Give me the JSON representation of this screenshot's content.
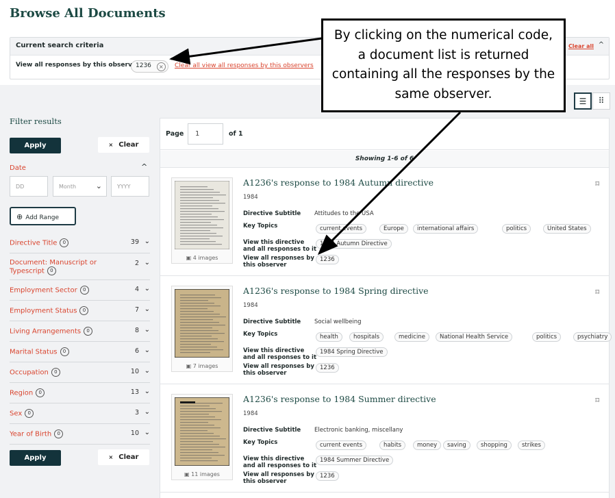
{
  "page": {
    "title": "Browse All Documents"
  },
  "criteria": {
    "header": "Current search criteria",
    "row_label": "View all responses by this observer",
    "chip_value": "1236",
    "chip_remove": "×",
    "clear_link": "Clear all view all responses by this observers",
    "clear_all": "Clear all",
    "collapse": "^"
  },
  "view": {
    "list_icon": "☰",
    "grid_icon": "⠿"
  },
  "filters": {
    "title": "Filter results",
    "apply": "Apply",
    "clear": "Clear",
    "clear_icon": "×",
    "date": {
      "label": "Date",
      "caret": "^",
      "dd_placeholder": "DD",
      "month_placeholder": "Month",
      "month_caret": "⌄",
      "yyyy_placeholder": "YYYY",
      "add_range": "Add Range",
      "add_icon": "⊕"
    },
    "facets": [
      {
        "label": "Directive Title",
        "badge": "0",
        "count": "39"
      },
      {
        "label": "Document: Manuscript or Typescript",
        "badge": "0",
        "count": "2"
      },
      {
        "label": "Employment Sector",
        "badge": "0",
        "count": "4"
      },
      {
        "label": "Employment Status",
        "badge": "0",
        "count": "7"
      },
      {
        "label": "Living Arrangements",
        "badge": "0",
        "count": "8"
      },
      {
        "label": "Marital Status",
        "badge": "0",
        "count": "6"
      },
      {
        "label": "Occupation",
        "badge": "0",
        "count": "10"
      },
      {
        "label": "Region",
        "badge": "0",
        "count": "13"
      },
      {
        "label": "Sex",
        "badge": "0",
        "count": "3"
      },
      {
        "label": "Year of Birth",
        "badge": "0",
        "count": "10"
      }
    ],
    "facet_caret": "⌄"
  },
  "results": {
    "page_label": "Page",
    "page_value": "1",
    "of_label": "of 1",
    "showing": "Showing 1-6 of 6",
    "labels": {
      "directive_subtitle": "Directive Subtitle",
      "key_topics": "Key Topics",
      "view_directive_1": "View this directive",
      "view_directive_2": "and all responses to it",
      "view_observer_1": "View all responses by",
      "view_observer_2": "this observer"
    },
    "bookmark_icon": "⌑",
    "items": [
      {
        "title": "A1236's response to 1984 Autumn directive",
        "year": "1984",
        "subtitle": "Attitudes to the USA",
        "topics": [
          "current events",
          "Europe",
          "international affairs",
          "politics",
          "United States"
        ],
        "directive": "1984 Autumn Directive",
        "observer": "1236",
        "images": "4 images"
      },
      {
        "title": "A1236's response to 1984 Spring directive",
        "year": "1984",
        "subtitle": "Social wellbeing",
        "topics": [
          "health",
          "hospitals",
          "medicine",
          "National Health Service",
          "politics",
          "psychiatry"
        ],
        "directive": "1984 Spring Directive",
        "observer": "1236",
        "images": "7 images"
      },
      {
        "title": "A1236's response to 1984 Summer directive",
        "year": "1984",
        "subtitle": "Electronic banking, miscellany",
        "topics": [
          "current events",
          "habits",
          "money",
          "saving",
          "shopping",
          "strikes"
        ],
        "directive": "1984 Summer Directive",
        "observer": "1236",
        "images": "11 images"
      }
    ]
  },
  "callout": {
    "line1": "By clicking on the numerical code,",
    "line2": "a document list is returned",
    "line3": "containing all the responses by the",
    "line4": "same observer."
  }
}
